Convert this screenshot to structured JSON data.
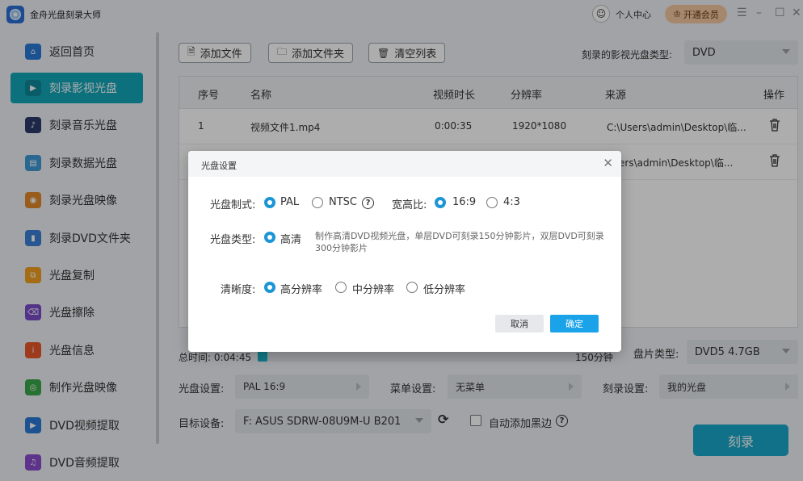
{
  "app": {
    "title": "金舟光盘刻录大师",
    "user_center": "个人中心",
    "vip_label": "开通会员"
  },
  "sidebar": {
    "items": [
      {
        "label": "返回首页",
        "icon": "home-icon",
        "color": "#2b7ad8"
      },
      {
        "label": "刻录影视光盘",
        "icon": "video-disc-icon",
        "color": "#0f8a9a"
      },
      {
        "label": "刻录音乐光盘",
        "icon": "music-disc-icon",
        "color": "#2b3a6b"
      },
      {
        "label": "刻录数据光盘",
        "icon": "data-disc-icon",
        "color": "#3e9ad6"
      },
      {
        "label": "刻录光盘映像",
        "icon": "image-disc-icon",
        "color": "#e08a2a"
      },
      {
        "label": "刻录DVD文件夹",
        "icon": "dvd-folder-icon",
        "color": "#3b7fd6"
      },
      {
        "label": "光盘复制",
        "icon": "copy-disc-icon",
        "color": "#f0a020"
      },
      {
        "label": "光盘擦除",
        "icon": "erase-disc-icon",
        "color": "#7b4cc8"
      },
      {
        "label": "光盘信息",
        "icon": "info-disc-icon",
        "color": "#e8572a"
      },
      {
        "label": "制作光盘映像",
        "icon": "make-image-icon",
        "color": "#3aa84b"
      },
      {
        "label": "DVD视频提取",
        "icon": "video-extract-icon",
        "color": "#2a7ad6"
      },
      {
        "label": "DVD音频提取",
        "icon": "audio-extract-icon",
        "color": "#8a4ccf"
      }
    ]
  },
  "toolbar": {
    "add_file": "添加文件",
    "add_folder": "添加文件夹",
    "clear_list": "清空列表",
    "disc_type_label": "刻录的影视光盘类型:",
    "disc_type_value": "DVD"
  },
  "table": {
    "headers": [
      "序号",
      "名称",
      "视频时长",
      "分辨率",
      "来源",
      "操作"
    ],
    "rows": [
      {
        "index": "1",
        "name": "视频文件1.mp4",
        "duration": "0:00:35",
        "resolution": "1920*1080",
        "source": "C:\\Users\\admin\\Desktop\\临..."
      },
      {
        "index": "",
        "name": "",
        "duration": "",
        "resolution": "",
        "source": "Users\\admin\\Desktop\\临..."
      }
    ]
  },
  "bottom": {
    "total_time_label": "总时间: 0:04:45",
    "capacity_text": "150分钟",
    "progress_fraction": 0.025,
    "disc_kind_label": "盘片类型:",
    "disc_kind_value": "DVD5 4.7GB",
    "disc_settings_label": "光盘设置:",
    "disc_settings_value": "PAL 16:9",
    "menu_label": "菜单设置:",
    "menu_value": "无菜单",
    "burn_settings_label": "刻录设置:",
    "burn_settings_value": "我的光盘",
    "target_label": "目标设备:",
    "target_value": "F: ASUS SDRW-08U9M-U B201",
    "auto_black_label": "自动添加黑边",
    "burn_button": "刻录"
  },
  "dialog": {
    "title": "光盘设置",
    "format_label": "光盘制式:",
    "format_options": [
      "PAL",
      "NTSC"
    ],
    "aspect_label": "宽高比:",
    "aspect_options": [
      "16:9",
      "4:3"
    ],
    "type_label": "光盘类型:",
    "type_value": "高清",
    "type_desc": "制作高清DVD视频光盘，单层DVD可刻录150分钟影片，双层DVD可刻录300分钟影片",
    "clarity_label": "清晰度:",
    "clarity_options": [
      "高分辨率",
      "中分辨率",
      "低分辨率"
    ],
    "cancel": "取消",
    "ok": "确定"
  }
}
